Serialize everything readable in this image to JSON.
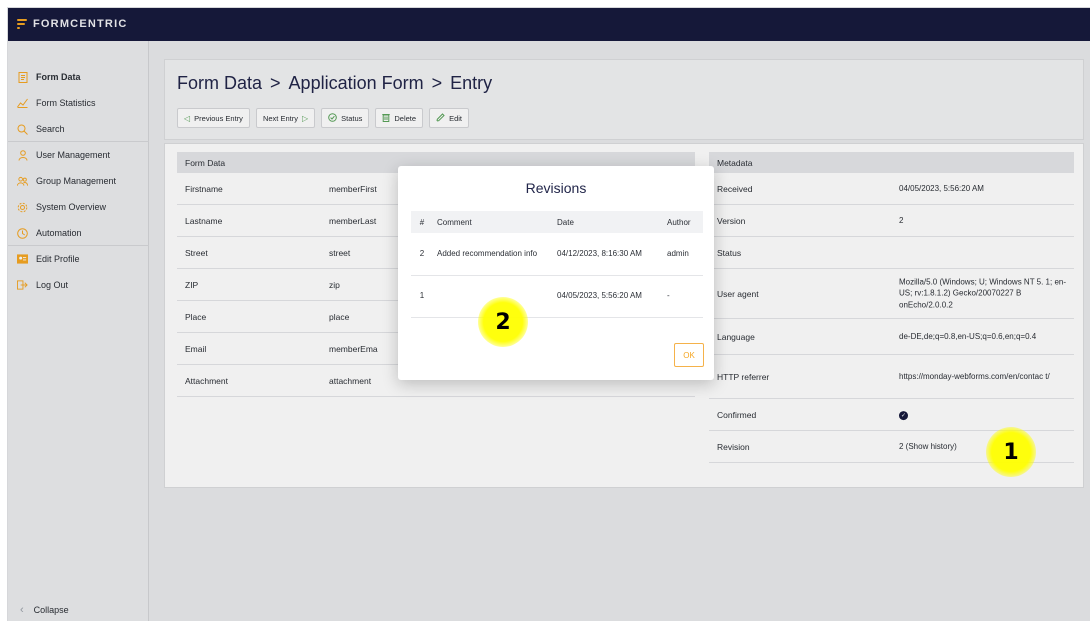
{
  "app": {
    "logo_text": "FORMCENTRIC"
  },
  "sidebar": {
    "items": [
      {
        "label": "Form Data",
        "icon": "form-data-icon"
      },
      {
        "label": "Form Statistics",
        "icon": "statistics-icon"
      },
      {
        "label": "Search",
        "icon": "search-icon"
      },
      {
        "label": "User Management",
        "icon": "user-icon"
      },
      {
        "label": "Group Management",
        "icon": "group-icon"
      },
      {
        "label": "System Overview",
        "icon": "gear-icon"
      },
      {
        "label": "Automation",
        "icon": "clock-icon"
      },
      {
        "label": "Edit Profile",
        "icon": "profile-card-icon"
      },
      {
        "label": "Log Out",
        "icon": "logout-icon"
      }
    ],
    "collapse_label": "Collapse"
  },
  "header": {
    "breadcrumb": [
      "Form Data",
      "Application Form",
      "Entry"
    ],
    "breadcrumb_sep": ">",
    "toolbar": {
      "previous_label": "Previous Entry",
      "next_label": "Next Entry",
      "status_label": "Status",
      "delete_label": "Delete",
      "edit_label": "Edit"
    }
  },
  "form_data": {
    "heading": "Form Data",
    "rows": [
      {
        "label": "Firstname",
        "field": "memberFirst"
      },
      {
        "label": "Lastname",
        "field": "memberLast"
      },
      {
        "label": "Street",
        "field": "street"
      },
      {
        "label": "ZIP",
        "field": "zip"
      },
      {
        "label": "Place",
        "field": "place"
      },
      {
        "label": "Email",
        "field": "memberEma"
      },
      {
        "label": "Attachment",
        "field": "attachment"
      }
    ]
  },
  "metadata": {
    "heading": "Metadata",
    "rows": [
      {
        "label": "Received",
        "value": "04/05/2023, 5:56:20 AM"
      },
      {
        "label": "Version",
        "value": "2"
      },
      {
        "label": "Status",
        "value": ""
      },
      {
        "label": "User agent",
        "value": "Mozilla/5.0 (Windows; U; Windows NT 5. 1; en-US; rv:1.8.1.2) Gecko/20070227 B onEcho/2.0.0.2"
      },
      {
        "label": "Language",
        "value": "de-DE,de;q=0.8,en-US;q=0.6,en;q=0.4"
      },
      {
        "label": "HTTP referrer",
        "value": "https://monday-webforms.com/en/contac t/"
      },
      {
        "label": "Confirmed",
        "value": ""
      },
      {
        "label": "Revision",
        "value": "2 (Show history)"
      }
    ]
  },
  "modal": {
    "title": "Revisions",
    "columns": [
      "#",
      "Comment",
      "Date",
      "Author"
    ],
    "rows": [
      {
        "num": "2",
        "comment": "Added recommendation info",
        "date": "04/12/2023, 8:16:30 AM",
        "author": "admin"
      },
      {
        "num": "1",
        "comment": "",
        "date": "04/05/2023, 5:56:20 AM",
        "author": "-"
      }
    ],
    "ok_label": "OK"
  },
  "annotations": {
    "marker_1": "1",
    "marker_2": "2"
  }
}
